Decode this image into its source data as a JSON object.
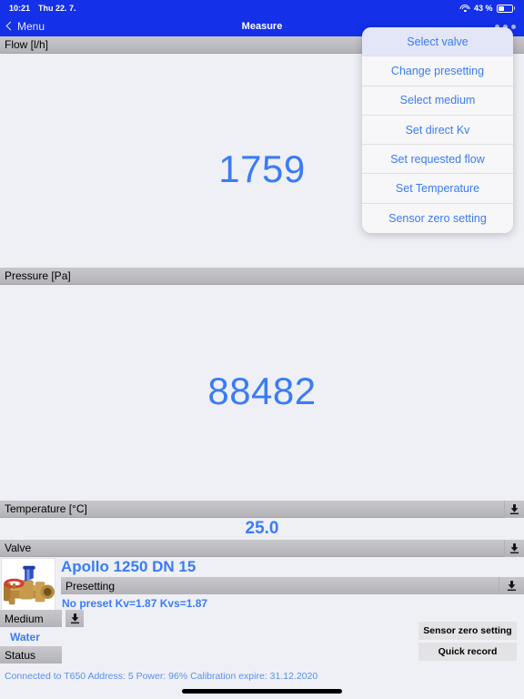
{
  "statusbar": {
    "time": "10:21",
    "date": "Thu 22. 7.",
    "battery_percent": "43 %",
    "battery_level": 43,
    "wifi_icon": "wifi-icon",
    "battery_icon": "battery-icon"
  },
  "navbar": {
    "back_label": "Menu",
    "title": "Measure",
    "more_icon": "ellipsis-icon"
  },
  "sections": {
    "flow": {
      "header": "Flow [l/h]",
      "value": "1759"
    },
    "pressure": {
      "header": "Pressure [Pa]",
      "value": "88482"
    },
    "temperature": {
      "header": "Temperature [°C]",
      "value": "25.0"
    },
    "valve": {
      "header": "Valve",
      "name": "Apollo 1250 DN 15",
      "presetting_header": "Presetting",
      "presetting_value": "No preset Kv=1.87 Kvs=1.87",
      "thumb_icon": "valve-thumbnail-icon"
    },
    "medium": {
      "header": "Medium",
      "value": "Water"
    },
    "status": {
      "header": "Status",
      "value": "Connected to T650 Address: 5 Power: 96% Calibration expire: 31.12.2020"
    }
  },
  "download_icon": "download-icon",
  "buttons": {
    "sensor_zero": "Sensor zero setting",
    "quick_record": "Quick record"
  },
  "popover": {
    "items": [
      {
        "label": "Select valve",
        "highlighted": true
      },
      {
        "label": "Change presetting",
        "highlighted": false
      },
      {
        "label": "Select medium",
        "highlighted": false
      },
      {
        "label": "Set direct Kv",
        "highlighted": false
      },
      {
        "label": "Set requested flow",
        "highlighted": false
      },
      {
        "label": "Set Temperature",
        "highlighted": false
      },
      {
        "label": "Sensor zero setting",
        "highlighted": false
      }
    ]
  },
  "colors": {
    "nav_blue": "#1430e8",
    "accent_blue": "#3b7bf6",
    "header_gray": "#bcbcc1",
    "page_bg": "#eef0f5"
  }
}
